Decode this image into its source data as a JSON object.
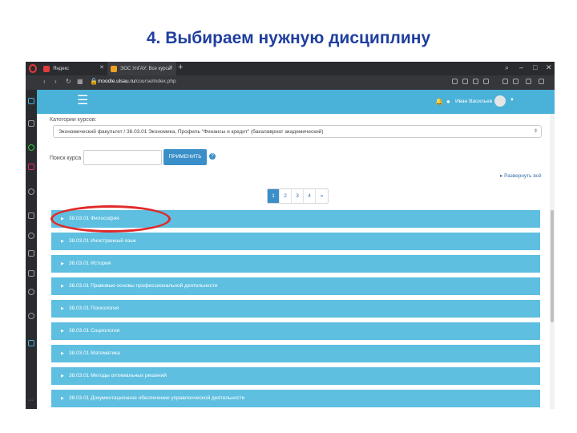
{
  "slide": {
    "title": "4. Выбираем нужную дисциплину"
  },
  "browser": {
    "tabs": [
      {
        "label": "Яндекс",
        "icon": "yandex-icon",
        "favicon_color": "#e23b3b"
      },
      {
        "label": "ЭОС УлГАУ: Все курсы",
        "icon": "site-favicon",
        "favicon_color": "#f0a020"
      }
    ],
    "url_host": "moodle.ulsau.ru",
    "url_path": "/course/index.php"
  },
  "moodle": {
    "user_name": "Иван Васильев",
    "categories_label": "Категории курсов:",
    "category_selected": "Экономический факультет / 38.03.01 Экономика, Профиль \"Финансы и кредит\" (бакалавриат академический)",
    "search_label": "Поиск курса",
    "apply_button": "ПРИМЕНИТЬ",
    "expand_all": "Развернуть всё",
    "pages": [
      "1",
      "2",
      "3",
      "4",
      "»"
    ],
    "active_page": "1",
    "courses": [
      "38.03.01 Философия",
      "38.03.01 Иностранный язык",
      "38.03.01 История",
      "38.03.01 Правовые основы профессиональной деятельности",
      "38.03.01 Психология",
      "38.03.01 Социология",
      "38.03.01 Математика",
      "38.03.01 Методы оптимальных решений",
      "38.03.01 Документационное обеспечение управленческой деятельности"
    ]
  },
  "colors": {
    "navbar": "#4ab1d8",
    "course_row": "#5ebfe0",
    "button": "#3b8fc9",
    "highlight": "#e12a2a",
    "title": "#1f3f9f"
  }
}
